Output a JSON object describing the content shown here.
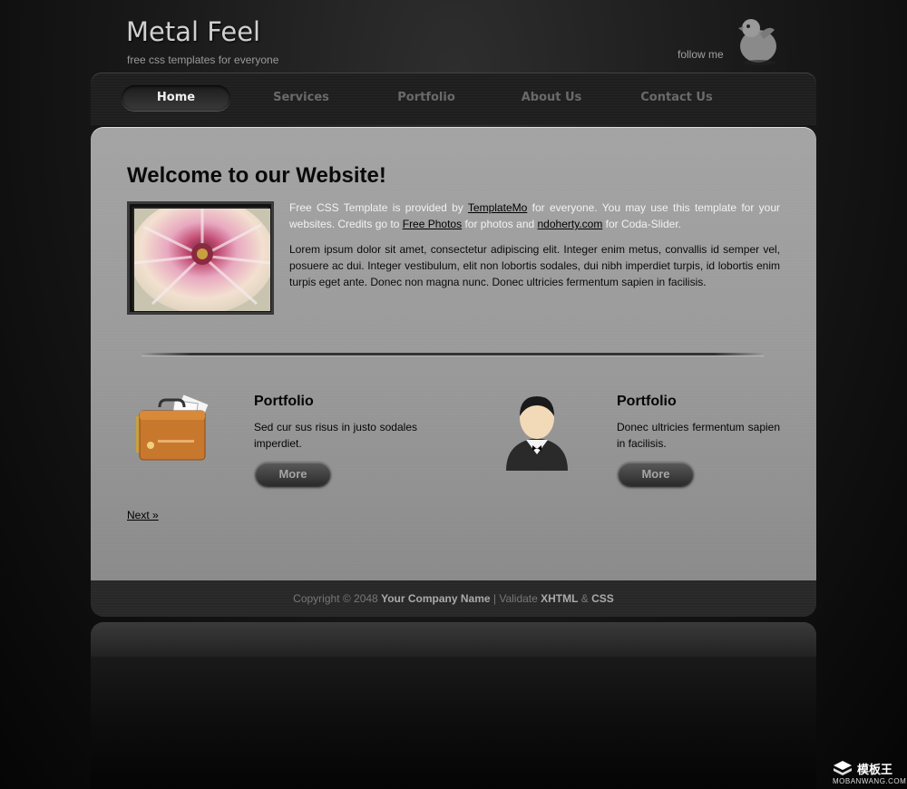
{
  "header": {
    "title": "Metal Feel",
    "tagline": "free css templates for everyone",
    "follow_text": "follow me"
  },
  "nav": {
    "items": [
      {
        "label": "Home",
        "active": true
      },
      {
        "label": "Services",
        "active": false
      },
      {
        "label": "Portfolio",
        "active": false
      },
      {
        "label": "About Us",
        "active": false
      },
      {
        "label": "Contact Us",
        "active": false
      }
    ]
  },
  "main": {
    "heading": "Welcome to our Website!",
    "intro": {
      "t1": "Free CSS Template is provided by ",
      "link1": "TemplateMo",
      "t2": " for everyone. You may use this template for your websites. Credits go to ",
      "link2": "Free Photos",
      "t3": " for photos and ",
      "link3": "ndoherty.com",
      "t4": " for Coda-Slider."
    },
    "lorem": "Lorem ipsum dolor sit amet, consectetur adipiscing elit. Integer enim metus, convallis id semper vel, posuere ac dui. Integer vestibulum, elit non lobortis sodales, dui nibh imperdiet turpis, id lobortis enim turpis eget ante. Donec non magna nunc. Donec ultricies fermentum sapien in facilisis.",
    "columns": [
      {
        "title": "Portfolio",
        "text": "Sed cur sus risus in justo sodales imperdiet.",
        "button": "More"
      },
      {
        "title": "Portfolio",
        "text": "Donec ultricies fermentum sapien in facilisis.",
        "button": "More"
      }
    ],
    "next_link": "Next »"
  },
  "footer": {
    "copyright": "Copyright © 2048 ",
    "company": "Your Company Name",
    "sep": " | Validate ",
    "xhtml": "XHTML",
    "amp": " & ",
    "css": "CSS"
  },
  "watermark": {
    "brand": "模板王",
    "url": "MOBANWANG.COM"
  }
}
